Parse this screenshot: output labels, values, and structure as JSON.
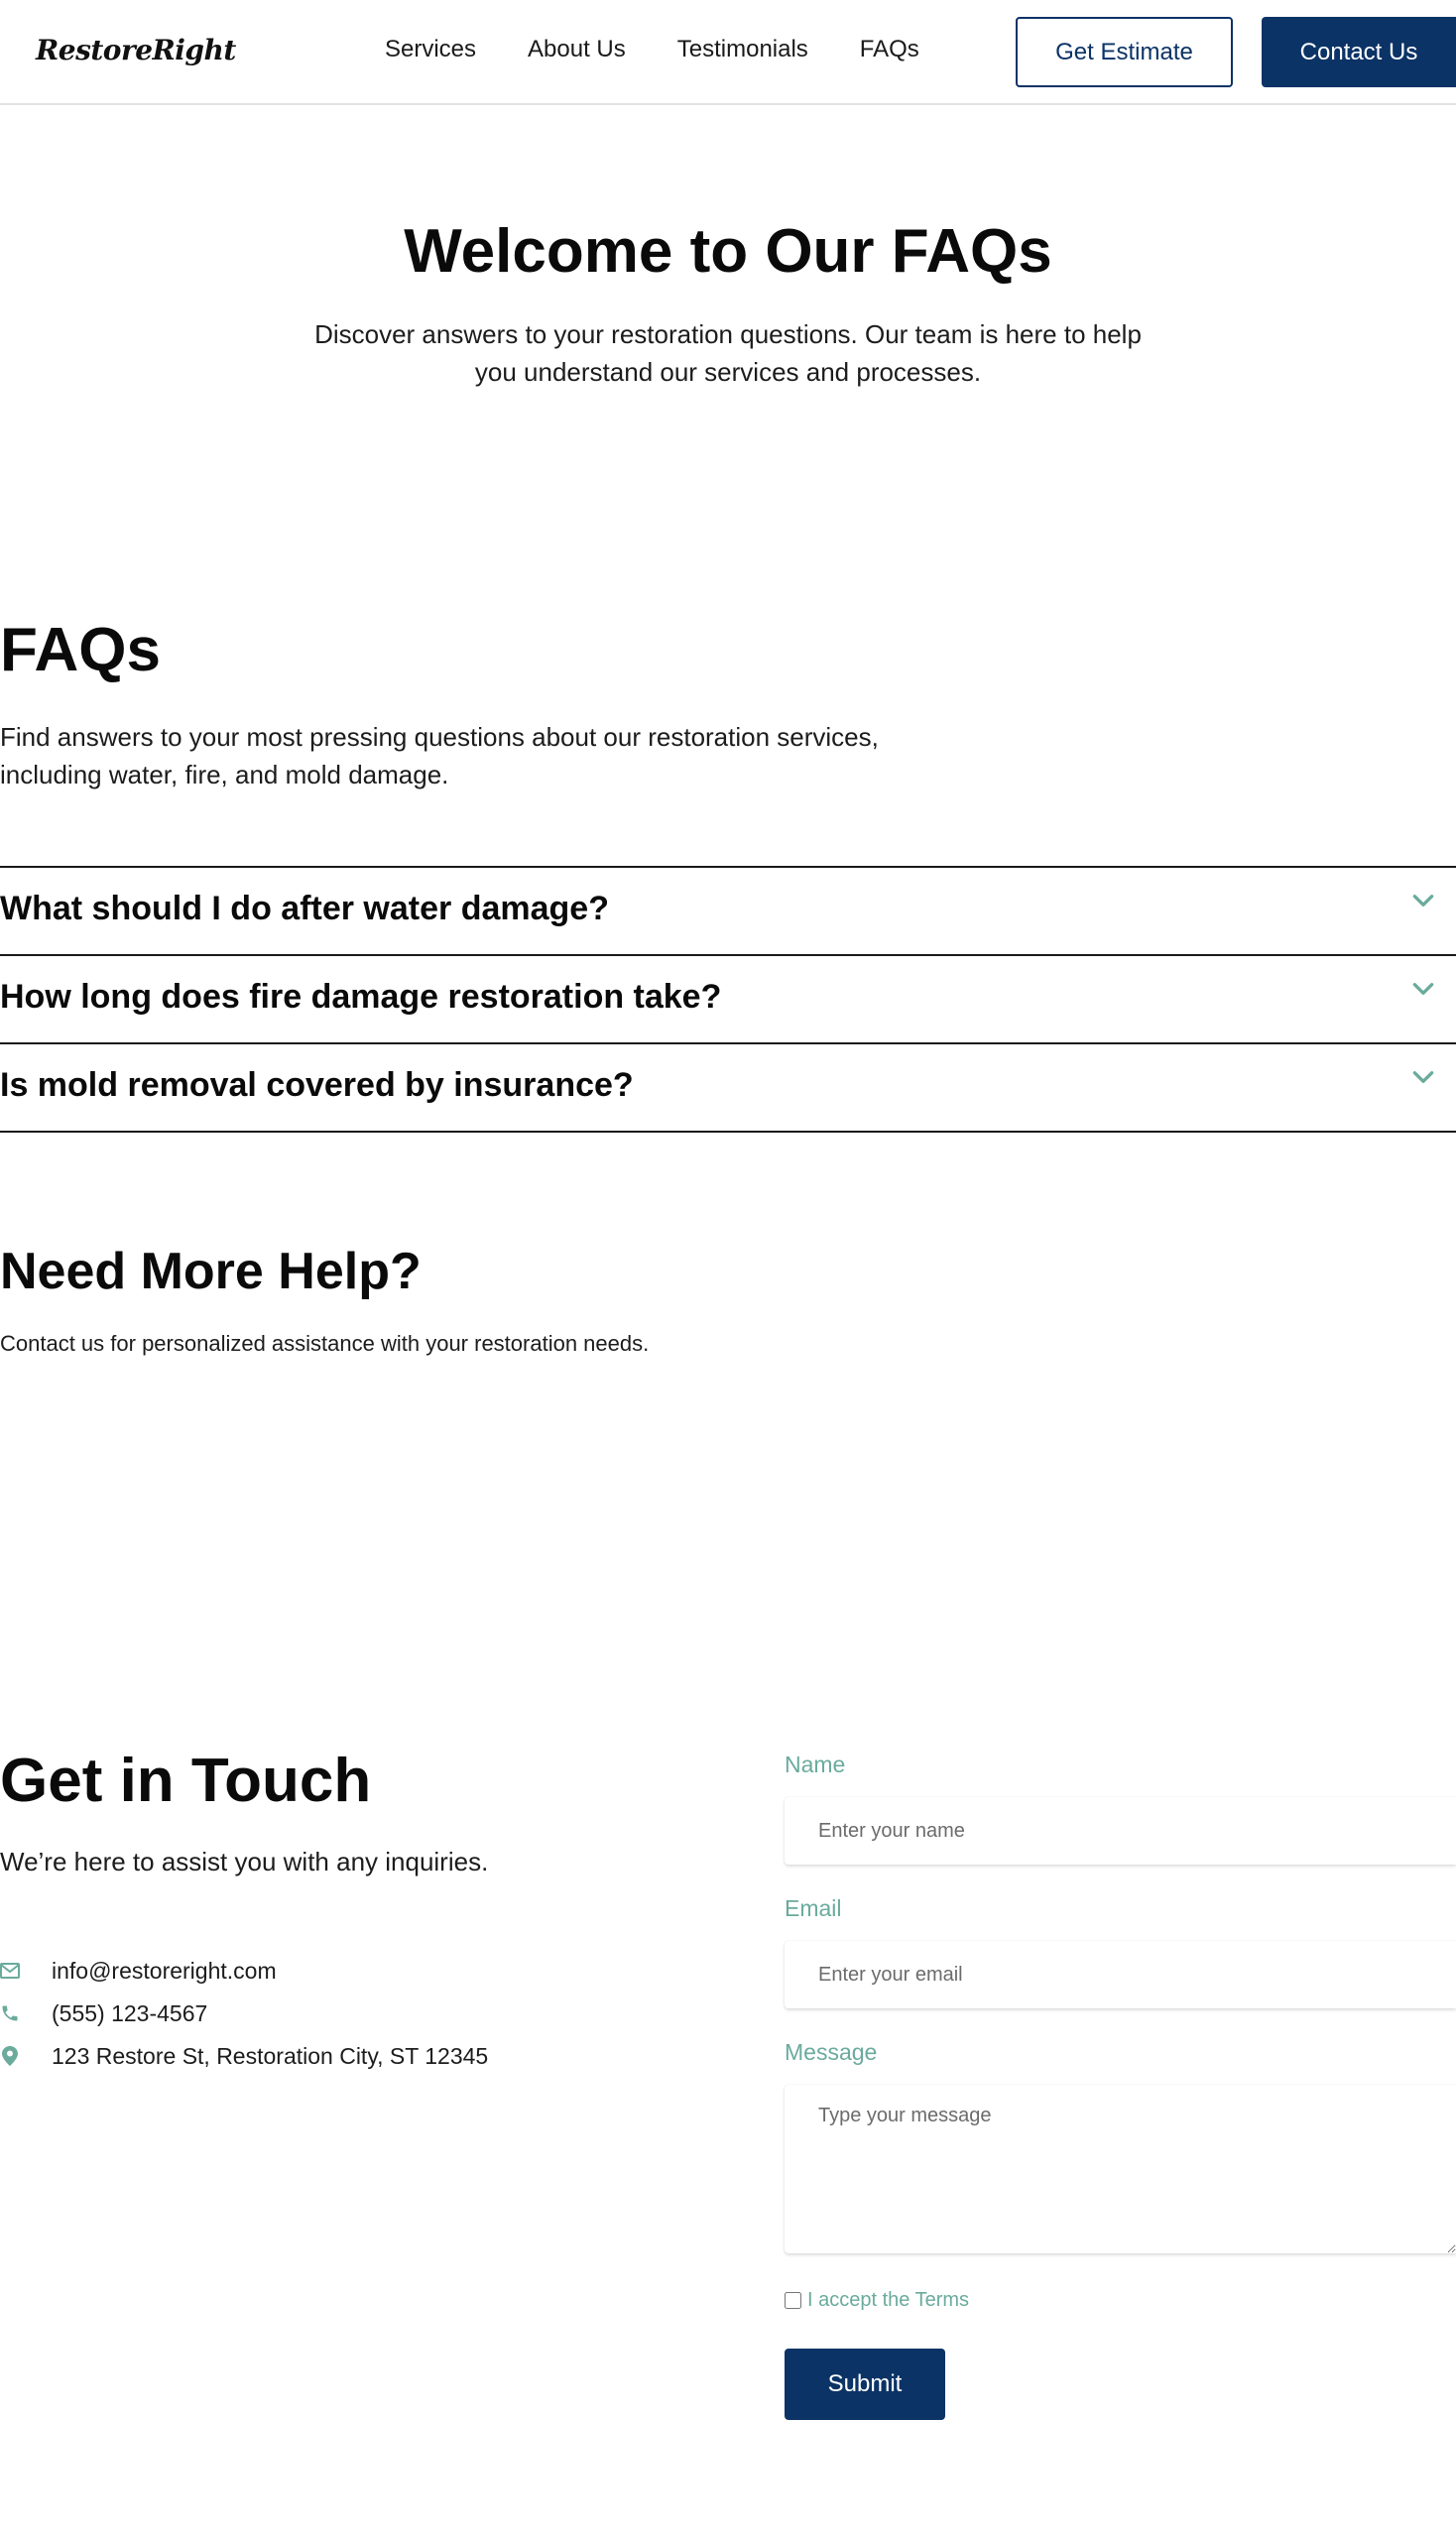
{
  "header": {
    "logo": "RestoreRight",
    "nav": [
      "Services",
      "About Us",
      "Testimonials",
      "FAQs"
    ],
    "estimate_label": "Get Estimate",
    "contact_label": "Contact Us"
  },
  "hero": {
    "title": "Welcome to Our FAQs",
    "subtitle": "Discover answers to your restoration questions. Our team is here to help you understand our services and processes."
  },
  "faqs": {
    "title": "FAQs",
    "subtitle": "Find answers to your most pressing questions about our restoration services, including water, fire, and mold damage.",
    "items": [
      "What should I do after water damage?",
      "How long does fire damage restoration take?",
      "Is mold removal covered by insurance?"
    ]
  },
  "help": {
    "title": "Need More Help?",
    "subtitle": "Contact us for personalized assistance with your restoration needs."
  },
  "touch": {
    "title": "Get in Touch",
    "subtitle": "We’re here to assist you with any inquiries.",
    "email": "info@restoreright.com",
    "phone": "(555) 123-4567",
    "address": "123 Restore St, Restoration City, ST 12345"
  },
  "form": {
    "name_label": "Name",
    "name_placeholder": "Enter your name",
    "email_label": "Email",
    "email_placeholder": "Enter your email",
    "message_label": "Message",
    "message_placeholder": "Type your message",
    "terms_label": "I accept the Terms",
    "submit_label": "Submit"
  },
  "colors": {
    "primary": "#0b3366",
    "accent": "#6aab9c"
  },
  "icons": [
    "chevron-down-icon",
    "mail-icon",
    "phone-icon",
    "map-pin-icon"
  ]
}
